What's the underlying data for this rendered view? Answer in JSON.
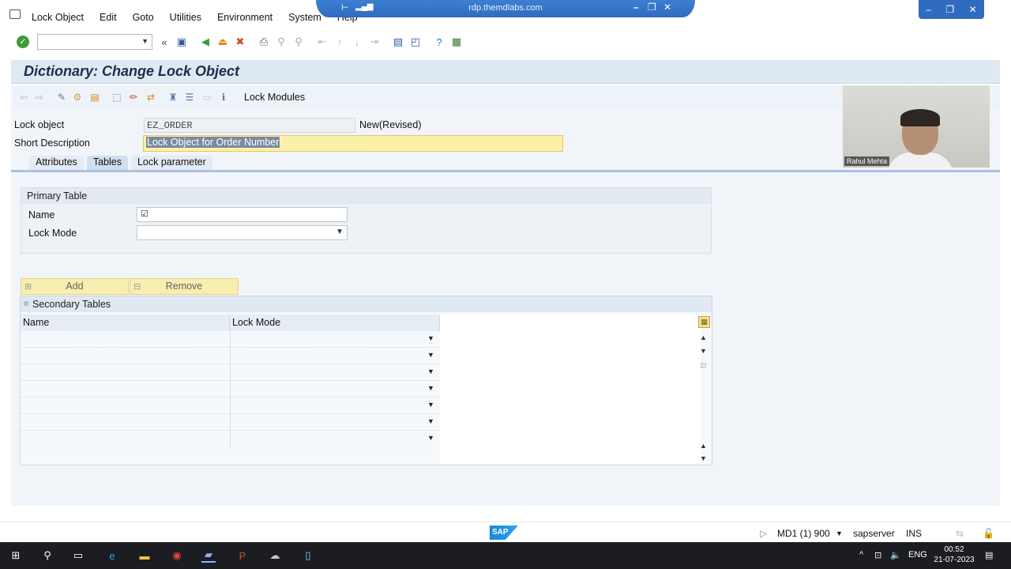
{
  "menubar": {
    "items": [
      "Lock Object",
      "Edit",
      "Goto",
      "Utilities",
      "Environment",
      "System",
      "Help"
    ]
  },
  "rdp": {
    "title": "rdp.themdlabs.com"
  },
  "title": "Dictionary: Change Lock Object",
  "app_toolbar": {
    "lock_modules_label": "Lock Modules"
  },
  "header": {
    "lock_object_label": "Lock object",
    "lock_object_value": "EZ_ORDER",
    "status": "New(Revised)",
    "short_desc_label": "Short Description",
    "short_desc_value": "Lock Object for Order Number"
  },
  "tabs": [
    "Attributes",
    "Tables",
    "Lock parameter"
  ],
  "primary": {
    "heading": "Primary Table",
    "name_label": "Name",
    "lock_mode_label": "Lock Mode"
  },
  "buttons": {
    "add": "Add",
    "remove": "Remove"
  },
  "secondary": {
    "heading": "Secondary Tables",
    "columns": [
      "Name",
      "Lock Mode"
    ]
  },
  "webcam": {
    "name": "Rahul Mehta"
  },
  "status": {
    "system": "MD1 (1) 900",
    "server": "sapserver",
    "mode": "INS",
    "logo": "SAP"
  },
  "taskbar": {
    "lang": "ENG",
    "time": "00:52",
    "date": "21-07-2023"
  }
}
